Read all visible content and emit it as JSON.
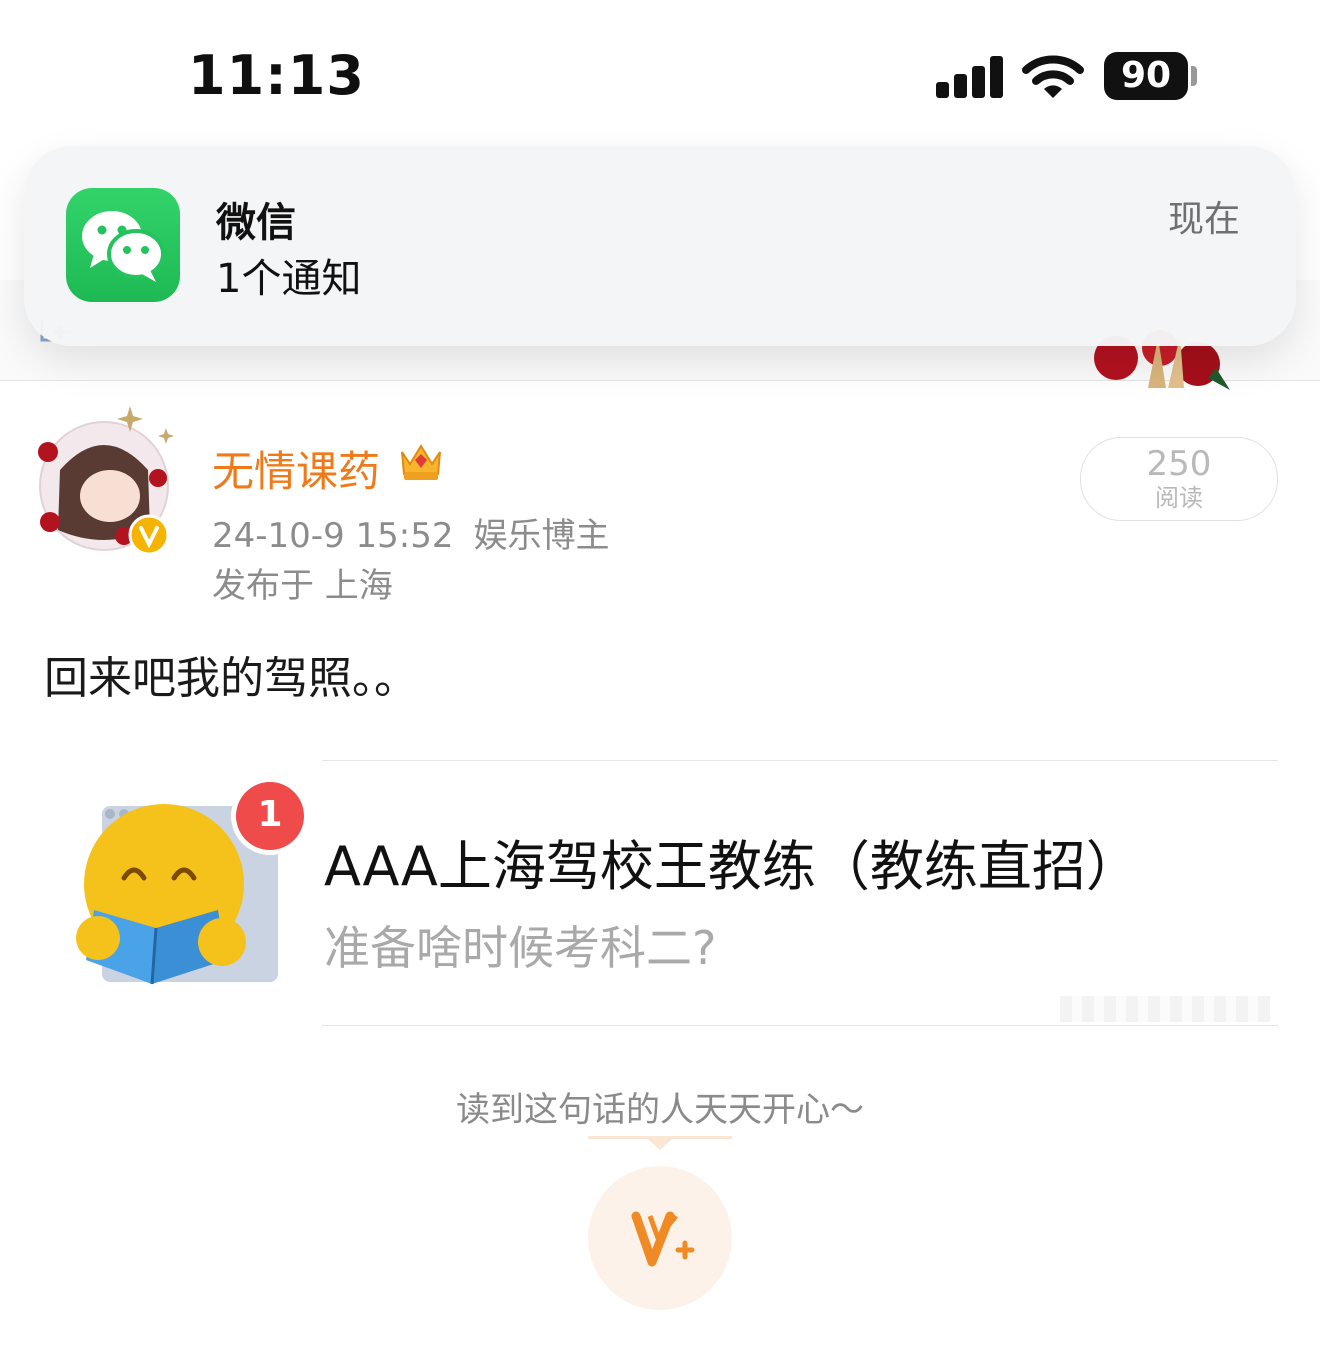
{
  "status_bar": {
    "time": "11:13",
    "battery": "90"
  },
  "notification": {
    "app_name": "微信",
    "body": "1个通知",
    "time": "现在",
    "icon": "wechat-icon"
  },
  "post": {
    "username": "无情课药",
    "date": "24-10-9 15:52",
    "tag": "娱乐博主",
    "location": "发布于 上海",
    "views_count": "250",
    "views_label": "阅读",
    "text": "回来吧我的驾照。。"
  },
  "shared_card": {
    "title": "AAA上海驾校王教练（教练直招）",
    "subtitle": "准备啥时候考科二?",
    "badge_count": "1"
  },
  "footer": {
    "caption": "读到这句话的人天天开心～"
  },
  "colors": {
    "username": "#f07a1a",
    "accent_orange": "#f08a24",
    "badge_red": "#ef4b4b",
    "wechat_green": "#25c35e"
  }
}
